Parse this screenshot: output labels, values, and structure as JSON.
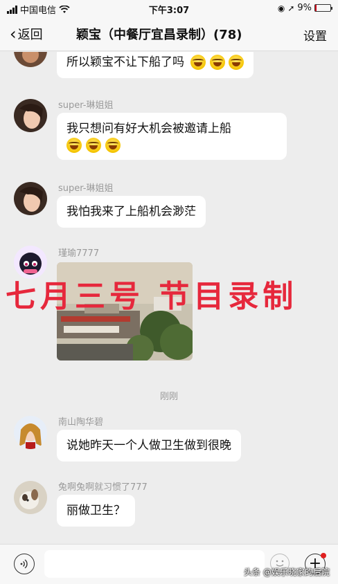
{
  "status_bar": {
    "carrier": "中国电信",
    "time": "下午3:07",
    "battery": "9%",
    "battery_level": 0.09,
    "battery_color": "#d0021b"
  },
  "nav": {
    "back_label": "返回",
    "title": "颖宝（中餐厅宜昌录制）(78)",
    "settings_label": "设置"
  },
  "messages": [
    {
      "sender": "",
      "text": "所以颖宝不让下船了吗",
      "emojis": [
        "laugh-cry-emoji",
        "laugh-cry-emoji",
        "laugh-cry-emoji"
      ]
    },
    {
      "sender": "super-琳姐姐",
      "text": "我只想问有好大机会被邀请上船",
      "emojis": [
        "laugh-cry-emoji",
        "laugh-cry-emoji",
        "laugh-cry-emoji"
      ]
    },
    {
      "sender": "super-琳姐姐",
      "text": "我怕我来了上船机会渺茫"
    },
    {
      "sender": "瑾瑜7777",
      "type": "image"
    },
    {
      "sender": "南山陶华碧",
      "text": "说她昨天一个人做卫生做到很晚"
    },
    {
      "sender": "兔啊兔啊就习惯了777",
      "text": "丽做卫生？"
    }
  ],
  "timestamp": "刚刚",
  "overlay_caption": "七月三号 节目录制",
  "overlay_color": "#e6283c",
  "input_bar": {
    "placeholder": ""
  },
  "source_watermark": "头条 @娱乐晓家的后院"
}
